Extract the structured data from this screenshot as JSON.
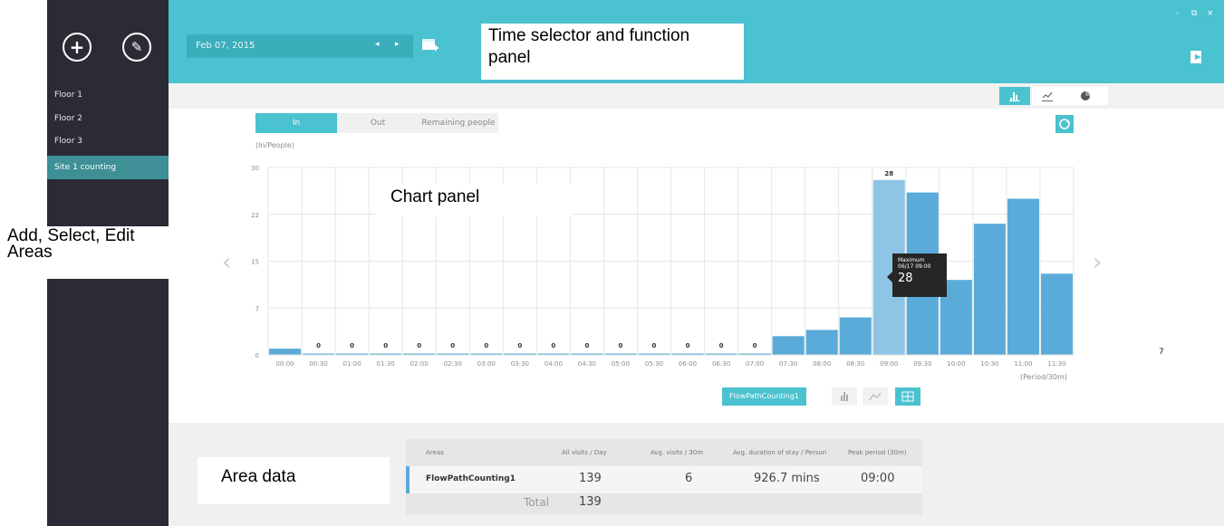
{
  "sidebar": {
    "add_label": "+",
    "edit_label": "✎",
    "items": [
      {
        "label": "Floor 1"
      },
      {
        "label": "Floor 2"
      },
      {
        "label": "Floor 3"
      },
      {
        "label": "Site 1 counting"
      }
    ]
  },
  "header": {
    "date": "Feb 07, 2015",
    "prev": "◂",
    "next": "▸",
    "win_min": "–",
    "win_restore": "⧉",
    "win_close": "×"
  },
  "annotations": {
    "time_selector": "Time selector and function\npanel",
    "chart_panel": "Chart panel",
    "areas": "Add, Select, Edit\nAreas",
    "area_data": "Area data"
  },
  "chart_controls": {
    "tabs": [
      "In",
      "Out",
      "Remaining people"
    ],
    "active_tab": "In",
    "y_unit": "(In/People)",
    "x_unit": "(Period/30m)",
    "legend": "FlowPathCounting1",
    "side_value": "7"
  },
  "tooltip": {
    "title": "Maximum",
    "time": "06/17 09:00",
    "value": "28"
  },
  "chart_data": {
    "type": "bar",
    "categories": [
      "00:00",
      "00:30",
      "01:00",
      "01:30",
      "02:00",
      "02:30",
      "03:00",
      "03:30",
      "04:00",
      "04:30",
      "05:00",
      "05:30",
      "06:00",
      "06:30",
      "07:00",
      "07:30",
      "08:00",
      "08:30",
      "09:00",
      "09:30",
      "10:00",
      "10:30",
      "11:00",
      "11:30"
    ],
    "values": [
      1,
      0,
      0,
      0,
      0,
      0,
      0,
      0,
      0,
      0,
      0,
      0,
      0,
      0,
      0,
      3,
      4,
      6,
      28,
      26,
      12,
      21,
      25,
      13
    ],
    "zero_labels": [
      "0",
      "0",
      "0",
      "0",
      "0",
      "0",
      "0",
      "0",
      "0",
      "0",
      "0",
      "0",
      "0",
      "0"
    ],
    "peak_label": "28",
    "yticks": [
      "30",
      "22",
      "15",
      "7",
      "0"
    ],
    "ylim": [
      0,
      30
    ],
    "color": "#5aabd9",
    "highlight_color": "#8ec5e6"
  },
  "table": {
    "headers": [
      "Areas",
      "All visits / Day",
      "Avg. visits / 30m",
      "Avg. duration of stay / Person",
      "Peak period (30m)"
    ],
    "row": [
      "FlowPathCounting1",
      "139",
      "6",
      "926.7 mins",
      "09:00"
    ],
    "total_label": "Total",
    "total_value": "139"
  }
}
